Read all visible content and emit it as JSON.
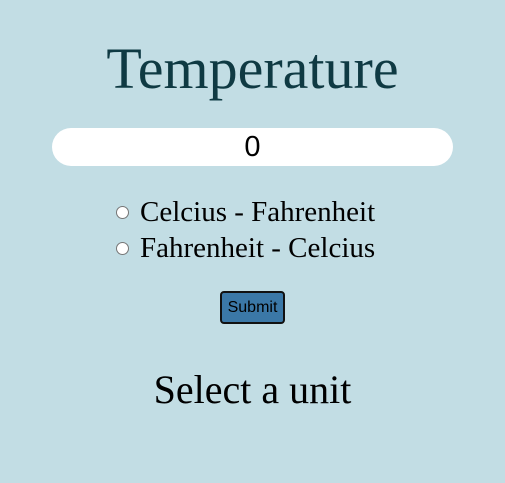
{
  "page": {
    "title": "Temperature",
    "background_color": "#c2dde4",
    "title_color": "#0f3a43"
  },
  "input": {
    "value": "0"
  },
  "options": [
    {
      "label": "Celcius - Fahrenheit",
      "checked": false
    },
    {
      "label": "Fahrenheit - Celcius",
      "checked": false
    }
  ],
  "submit": {
    "label": "Submit",
    "color": "#3b78a7"
  },
  "result": {
    "text": "Select a unit"
  }
}
